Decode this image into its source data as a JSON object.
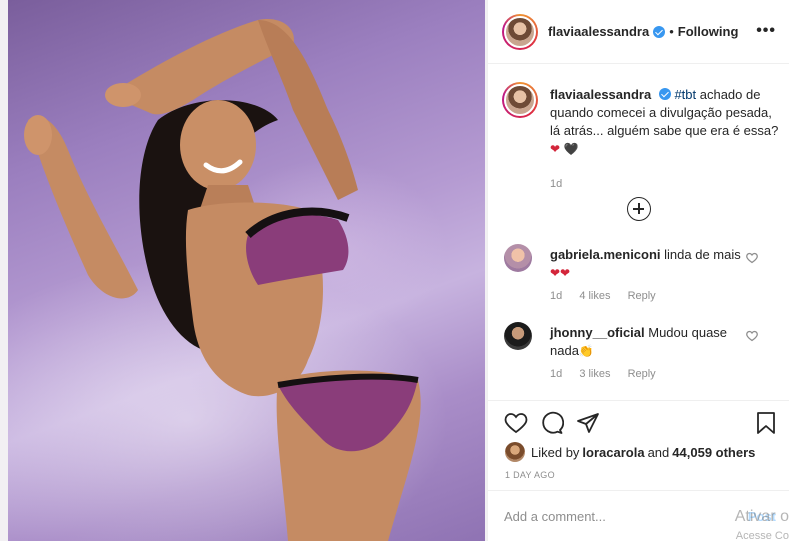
{
  "post": {
    "username": "flaviaalessandra",
    "separator": "•",
    "follow_status": "Following",
    "more_icon": "more-options-icon",
    "more_label": "•••"
  },
  "caption": {
    "username": "flaviaalessandra",
    "hashtag": "#tbt",
    "text": " achado de quando comecei a divulgação pesada, lá atrás... alguém sabe que era é essa?",
    "emojis": [
      "❤",
      "🖤"
    ],
    "age": "1d"
  },
  "comments": [
    {
      "username": "gabriela.meniconi",
      "text": " linda de mais",
      "emojis": "❤❤",
      "age": "1d",
      "likes": "4 likes",
      "reply": "Reply"
    },
    {
      "username": "jhonny__oficial",
      "text": " Mudou quase nada",
      "emojis": "👏",
      "age": "1d",
      "likes": "3 likes",
      "reply": "Reply"
    }
  ],
  "likes": {
    "prefix": "Liked by ",
    "user": "loracarola",
    "middle": " and ",
    "others": "44,059 others"
  },
  "time_ago": "1 DAY AGO",
  "add_comment": {
    "placeholder": "Add a comment...",
    "post_label": "Post"
  },
  "watermark": {
    "line1": "Ativar o",
    "line2": "Acesse Co"
  },
  "colors": {
    "verified": "#3897f0",
    "hashtag": "#00376b",
    "muted": "#8e8e8e",
    "heart": "#d3253a"
  }
}
